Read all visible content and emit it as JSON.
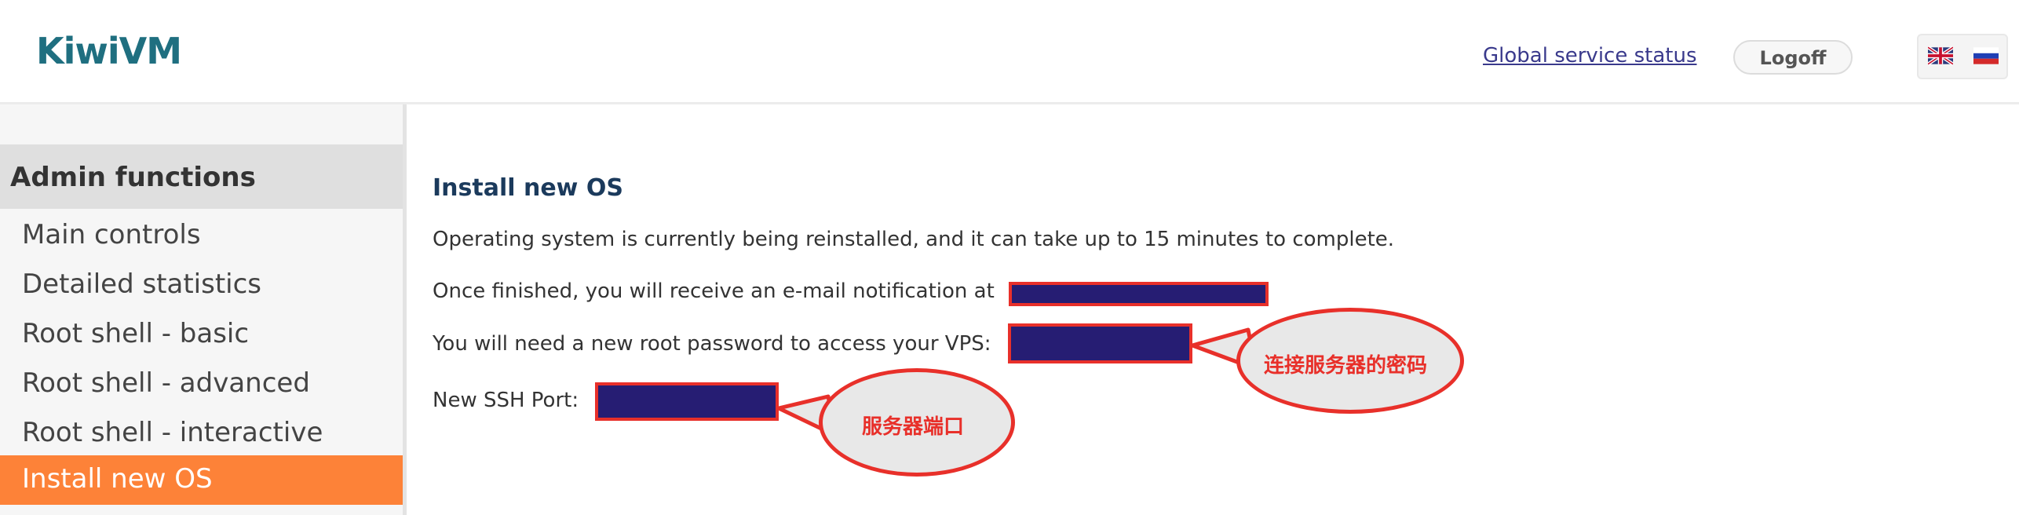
{
  "header": {
    "logo": "KiwiVM",
    "status_link": "Global service status",
    "logoff_label": "Logoff",
    "languages": [
      "English",
      "Russian"
    ]
  },
  "sidebar": {
    "section_title": "Admin functions",
    "items": [
      {
        "label": "Main controls",
        "active": false
      },
      {
        "label": "Detailed statistics",
        "active": false
      },
      {
        "label": "Root shell - basic",
        "active": false
      },
      {
        "label": "Root shell - advanced",
        "active": false
      },
      {
        "label": "Root shell - interactive",
        "active": false
      },
      {
        "label": "Install new OS",
        "active": true
      }
    ]
  },
  "main": {
    "title": "Install new OS",
    "status_line": "Operating system is currently being reinstalled, and it can take up to 15 minutes to complete.",
    "email_line": "Once finished, you will receive an e-mail notification at",
    "password_line": "You will need a new root password to access your VPS:",
    "ssh_port_line": "New SSH Port:"
  },
  "annotations": {
    "password_callout": "连接服务器的密码",
    "port_callout": "服务器端口"
  },
  "colors": {
    "accent": "#fd8238",
    "redaction": "#261d73",
    "callout_border": "#e8302a"
  }
}
